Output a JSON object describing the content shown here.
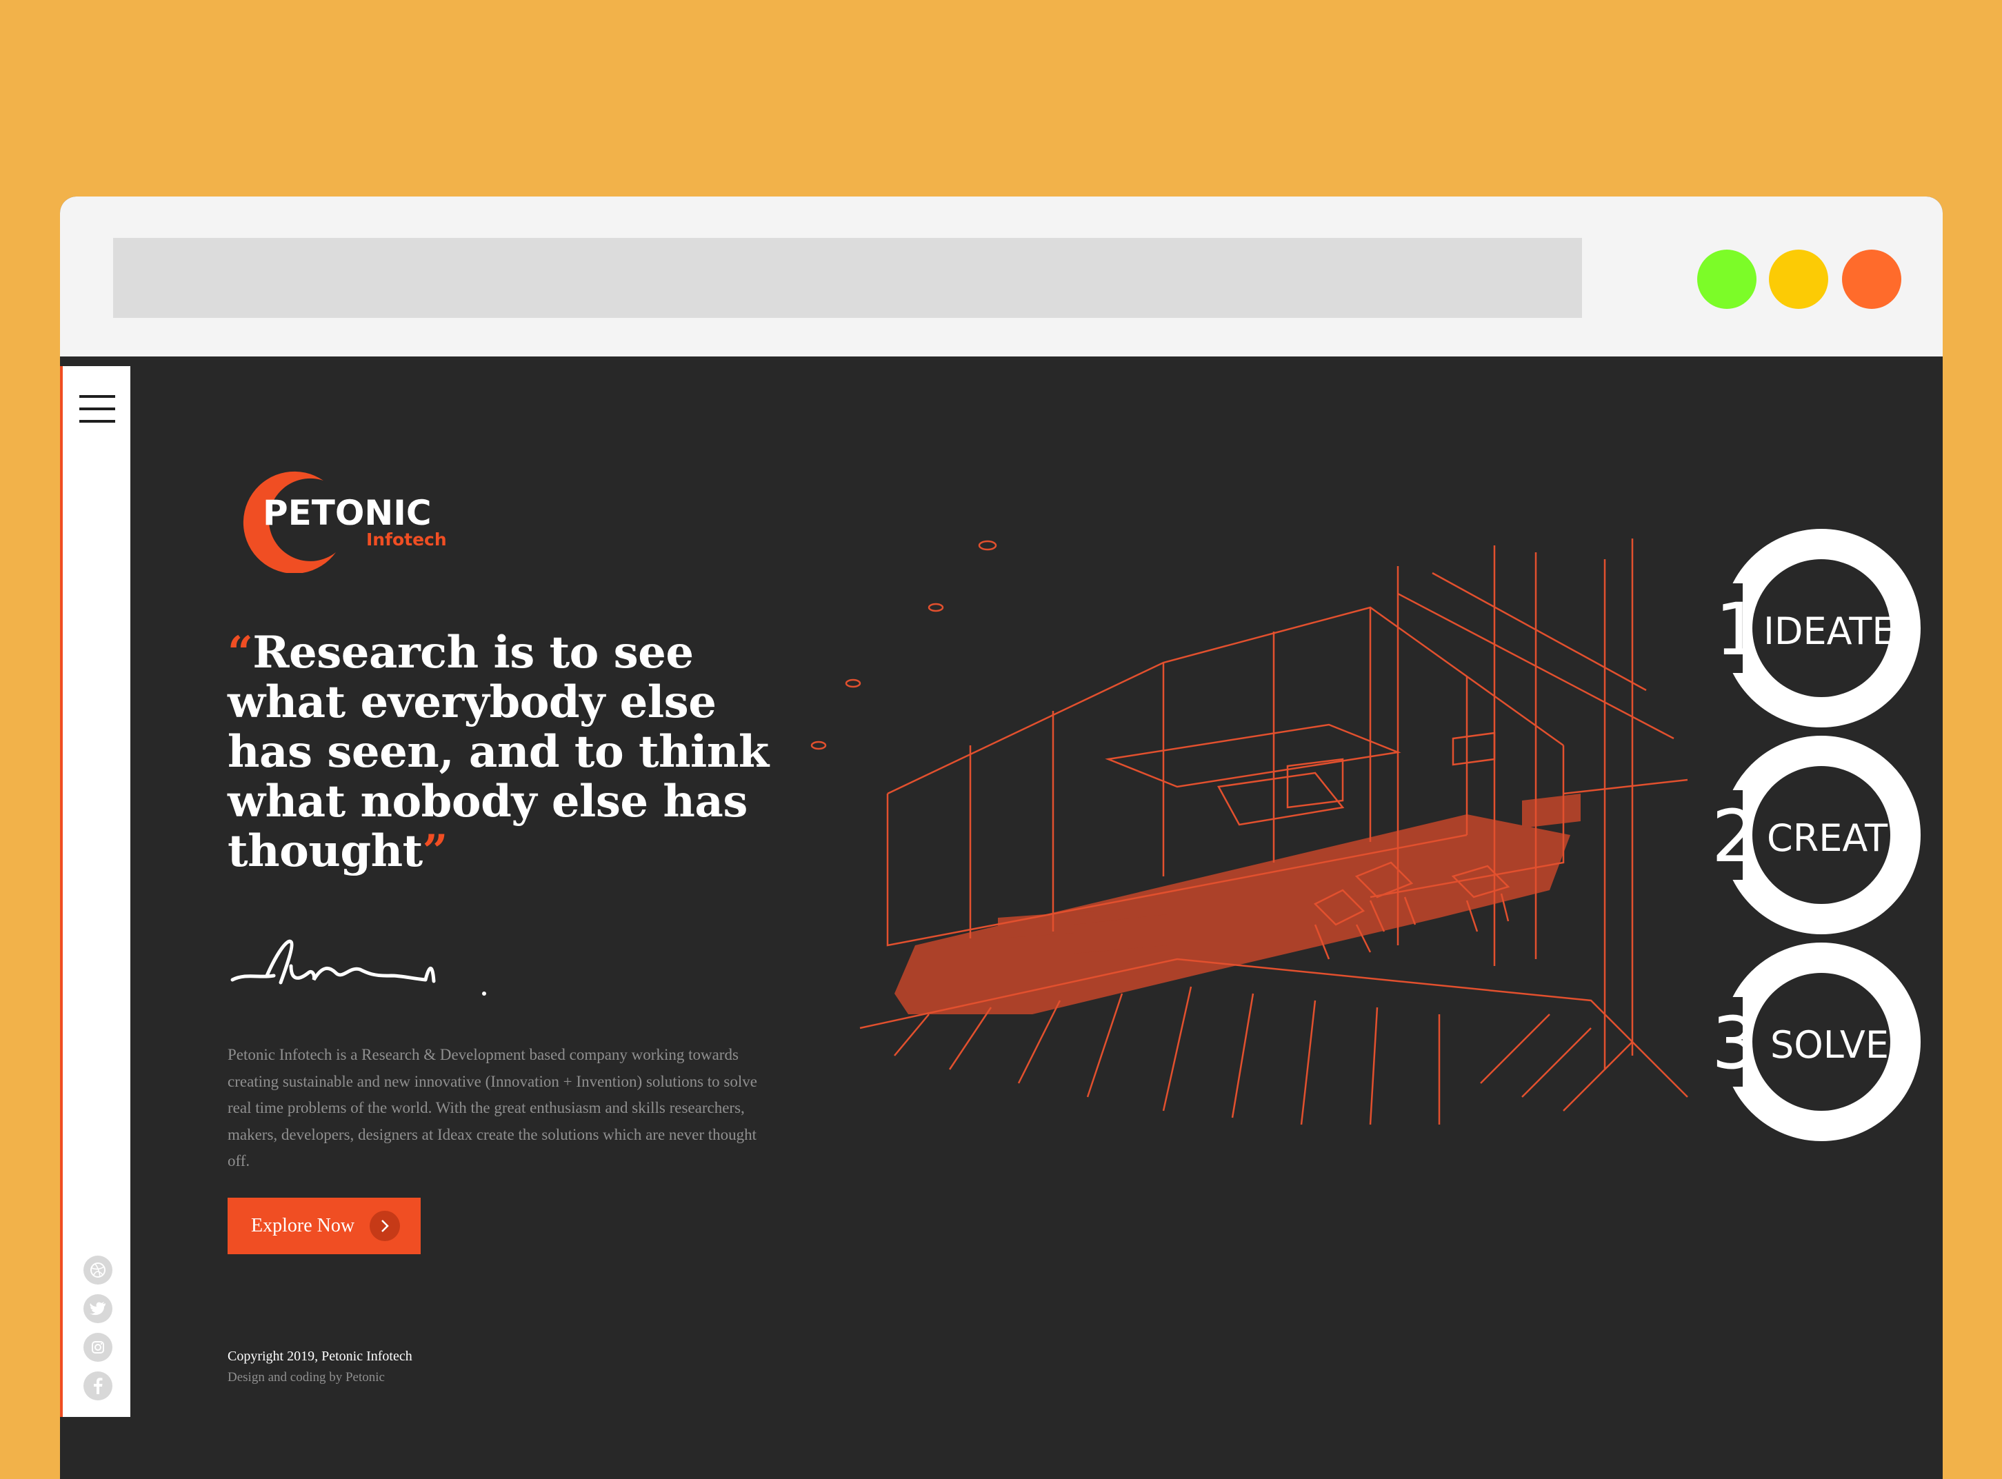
{
  "browser": {
    "window_controls": [
      {
        "name": "green",
        "color": "#7CFC28"
      },
      {
        "name": "yellow",
        "color": "#FCCB05"
      },
      {
        "name": "orange",
        "color": "#FF6B2B"
      }
    ]
  },
  "colors": {
    "background": "#F2B24A",
    "page_bg": "#282828",
    "accent": "#F04E23"
  },
  "brand": {
    "name": "PETONIC",
    "sub": "Infotech"
  },
  "hero": {
    "quote_open": "“",
    "quote_lines": [
      "Research is to see",
      "what everybody else",
      "has seen, and to think",
      "what nobody else has",
      "thought"
    ],
    "quote_close": "”",
    "description": "Petonic Infotech is a Research & Development based company working towards creating sustainable and new innovative (Innovation + Invention) solutions to solve real time problems of the world. With the great enthusiasm and skills researchers, makers, developers, designers at Ideax create the solutions which are never thought off.",
    "cta_label": "Explore Now"
  },
  "steps": [
    {
      "number": "1",
      "label": "IDEATE"
    },
    {
      "number": "2",
      "label": "CREATE"
    },
    {
      "number": "3",
      "label": "SOLVE"
    }
  ],
  "footer": {
    "copyright": "Copyright 2019, Petonic Infotech",
    "credit": "Design and coding by Petonic"
  },
  "social": [
    {
      "icon": "dribbble-icon"
    },
    {
      "icon": "twitter-icon"
    },
    {
      "icon": "instagram-icon"
    },
    {
      "icon": "facebook-icon"
    }
  ]
}
